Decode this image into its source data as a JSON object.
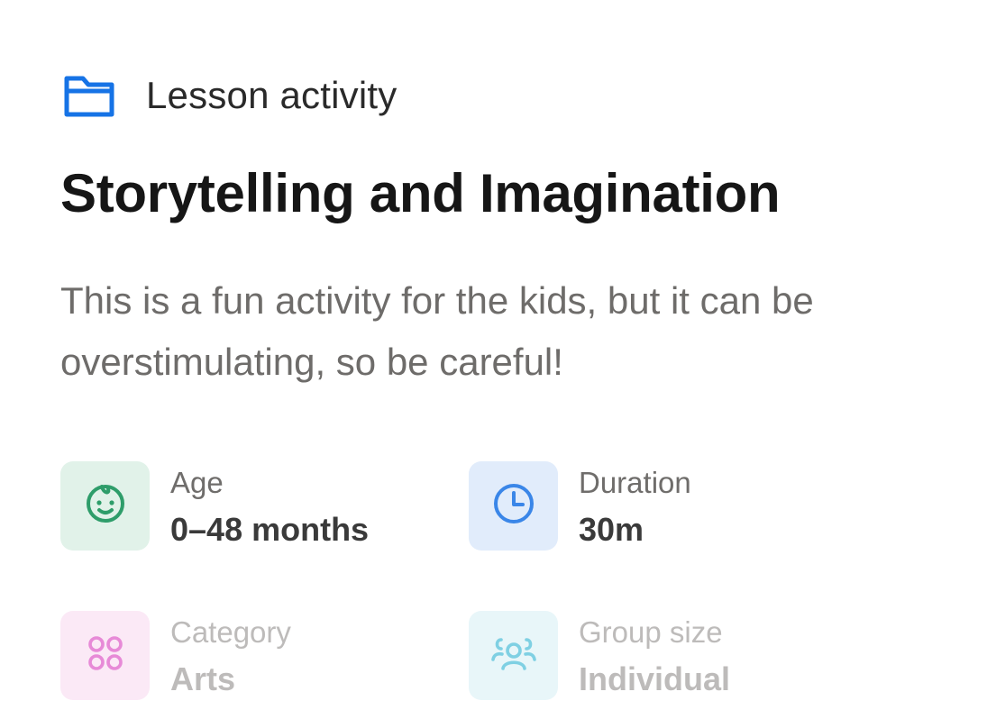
{
  "header": {
    "icon": "folder-icon",
    "label": "Lesson activity",
    "accent": "#1673e6"
  },
  "title": "Storytelling and Imagination",
  "description": "This is a fun activity for the kids, but it can be overstimulating, so be careful!",
  "meta": [
    {
      "key": "Age",
      "value": "0–48 months",
      "icon": "baby-face-icon",
      "color": "#2e9d6a"
    },
    {
      "key": "Duration",
      "value": "30m",
      "icon": "clock-icon",
      "color": "#3a86e8"
    },
    {
      "key": "Category",
      "value": "Arts",
      "icon": "grid-circles-icon",
      "color": "#e78ad7"
    },
    {
      "key": "Group size",
      "value": "Individual",
      "icon": "group-icon",
      "color": "#7fd0e3"
    }
  ]
}
